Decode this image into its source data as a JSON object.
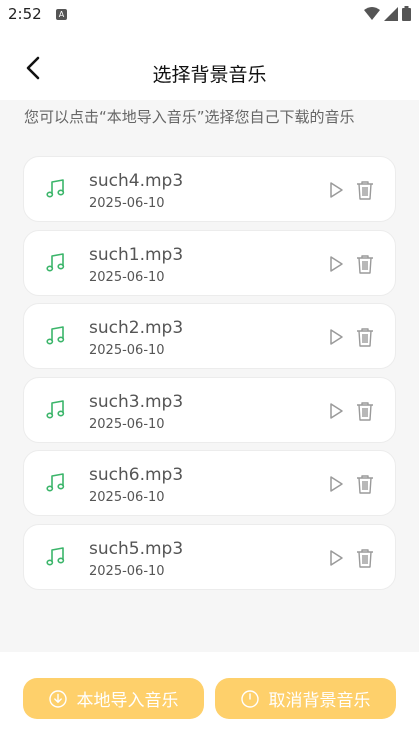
{
  "status": {
    "time": "2:52",
    "a_glyph": "A"
  },
  "header": {
    "title": "选择背景音乐"
  },
  "hint": "您可以点击“本地导入音乐”选择您自己下载的音乐",
  "tracks": [
    {
      "name": "such4.mp3",
      "date": "2025-06-10"
    },
    {
      "name": "such1.mp3",
      "date": "2025-06-10"
    },
    {
      "name": "such2.mp3",
      "date": "2025-06-10"
    },
    {
      "name": "such3.mp3",
      "date": "2025-06-10"
    },
    {
      "name": "such6.mp3",
      "date": "2025-06-10"
    },
    {
      "name": "such5.mp3",
      "date": "2025-06-10"
    }
  ],
  "buttons": {
    "import": "本地导入音乐",
    "cancel": "取消背景音乐"
  },
  "colors": {
    "accent": "#fed06b",
    "music_icon": "#3bb56a",
    "action_icon": "#9a9a9a"
  }
}
